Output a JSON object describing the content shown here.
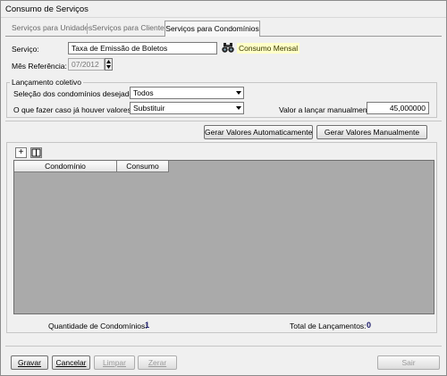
{
  "window": {
    "title": "Consumo de Serviços"
  },
  "tabs": [
    {
      "label": "Serviços para Unidades"
    },
    {
      "label": "Serviços para Clientes"
    },
    {
      "label": "Serviços para Condomínios"
    }
  ],
  "form": {
    "servico_label": "Serviço:",
    "servico_value": "Taxa de Emissão de Boletos",
    "servico_tipo": "Consumo Mensal",
    "mes_label": "Mês Referência:",
    "mes_value": "07/2012"
  },
  "lancamento": {
    "group_title": "Lançamento coletivo",
    "selecao_label": "Seleção dos condomínios desejados:",
    "selecao_value": "Todos",
    "fazer_label": "O que fazer caso já houver valores?",
    "fazer_value": "Substituir",
    "valor_label": "Valor a lançar manualmente:",
    "valor_value": "45,000000"
  },
  "actions": {
    "gerar_auto": "Gerar Valores Automaticamente",
    "gerar_manual": "Gerar Valores Manualmente"
  },
  "grid": {
    "add_label": "+",
    "columns": [
      "Condomínio",
      "Consumo"
    ]
  },
  "summary": {
    "qtd_label": "Quantidade de Condomínios:",
    "qtd_value": "1",
    "total_label": "Total de Lançamentos:",
    "total_value": "0"
  },
  "footer": {
    "gravar": "Gravar",
    "cancelar": "Cancelar",
    "limpar": "Limpar",
    "zerar": "Zerar",
    "sair": "Sair"
  }
}
